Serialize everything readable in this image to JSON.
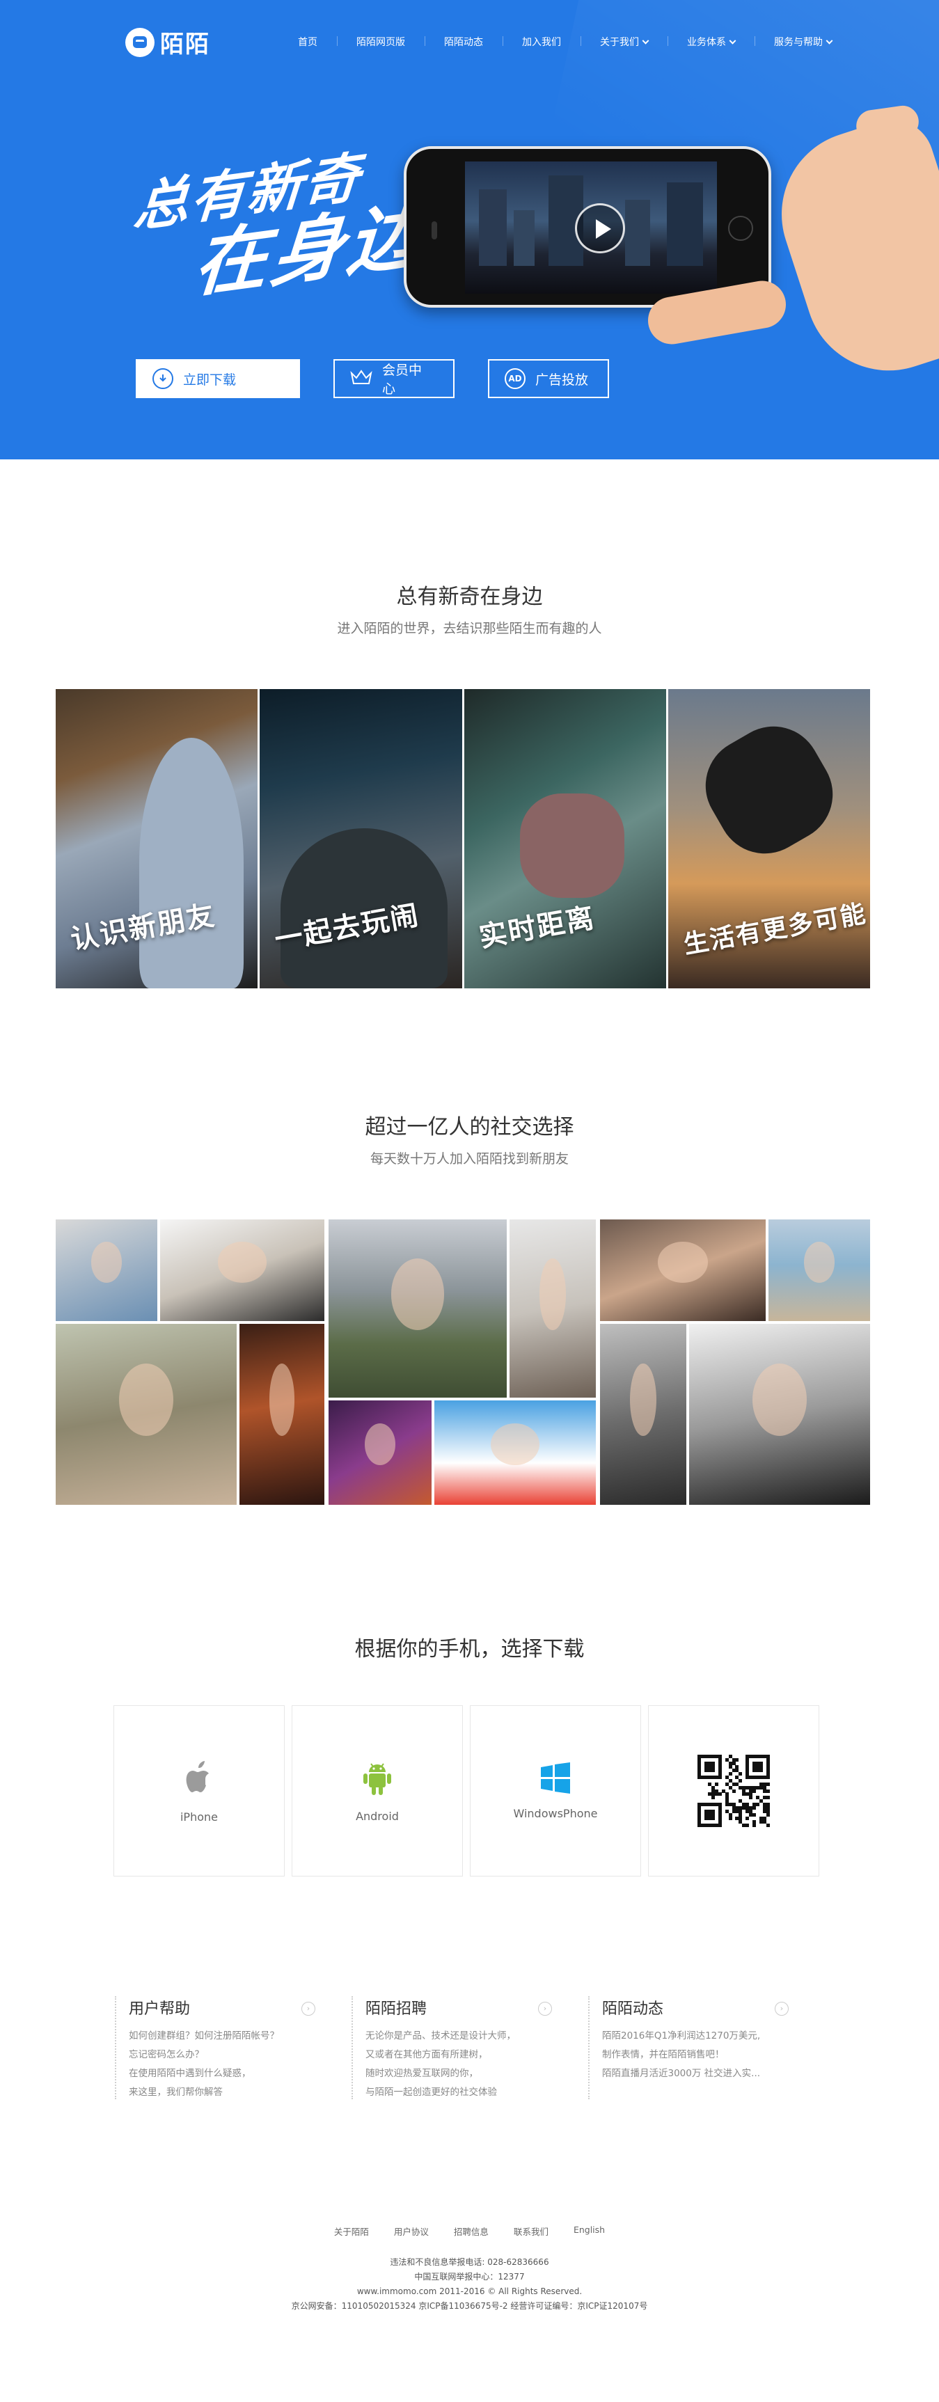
{
  "header": {
    "brand": "陌陌",
    "nav": [
      {
        "label": "首页",
        "dropdown": false
      },
      {
        "label": "陌陌网页版",
        "dropdown": false
      },
      {
        "label": "陌陌动态",
        "dropdown": false
      },
      {
        "label": "加入我们",
        "dropdown": false
      },
      {
        "label": "关于我们",
        "dropdown": true
      },
      {
        "label": "业务体系",
        "dropdown": true
      },
      {
        "label": "服务与帮助",
        "dropdown": true
      }
    ]
  },
  "hero": {
    "slogan_line1": "总有新奇",
    "slogan_line2": "在身边",
    "cta_download": "立即下载",
    "cta_member": "会员中心",
    "cta_ads": "广告投放",
    "ads_icon_text": "AD",
    "bg_color": "#2479e5"
  },
  "section1": {
    "title": "总有新奇在身边",
    "subtitle": "进入陌陌的世界，去结识那些陌生而有趣的人",
    "features": [
      {
        "label": "认识新朋友"
      },
      {
        "label": "一起去玩闹"
      },
      {
        "label": "实时距离"
      },
      {
        "label": "生活有更多可能"
      }
    ]
  },
  "section2": {
    "title": "超过一亿人的社交选择",
    "subtitle": "每天数十万人加入陌陌找到新朋友"
  },
  "section3": {
    "title": "根据你的手机，选择下载",
    "platforms": [
      {
        "label": "iPhone",
        "icon": "apple-icon"
      },
      {
        "label": "Android",
        "icon": "android-icon"
      },
      {
        "label": "WindowsPhone",
        "icon": "windows-icon"
      },
      {
        "label": "",
        "icon": "qr-code-icon"
      }
    ]
  },
  "help": [
    {
      "title": "用户帮助",
      "lines": [
        "如何创建群组？如何注册陌陌帐号？",
        "忘记密码怎么办？",
        "在使用陌陌中遇到什么疑惑，",
        "来这里，我们帮你解答"
      ]
    },
    {
      "title": "陌陌招聘",
      "lines": [
        "无论你是产品、技术还是设计大师，",
        "又或者在其他方面有所建树，",
        "随时欢迎热爱互联网的你，",
        "与陌陌一起创造更好的社交体验"
      ]
    },
    {
      "title": "陌陌动态",
      "lines": [
        "陌陌2016年Q1净利润达1270万美元,",
        "制作表情，并在陌陌销售吧！",
        "陌陌直播月活近3000万 社交进入实..."
      ]
    }
  ],
  "footer": {
    "links": [
      "关于陌陌",
      "用户协议",
      "招聘信息",
      "联系我们",
      "English"
    ],
    "info": [
      "违法和不良信息举报电话: 028-62836666",
      "中国互联网举报中心：12377",
      "www.immomo.com 2011-2016 © All Rights Reserved.",
      "京公网安备：11010502015324 京ICP备11036675号-2 经营许可证编号：京ICP证120107号"
    ]
  }
}
